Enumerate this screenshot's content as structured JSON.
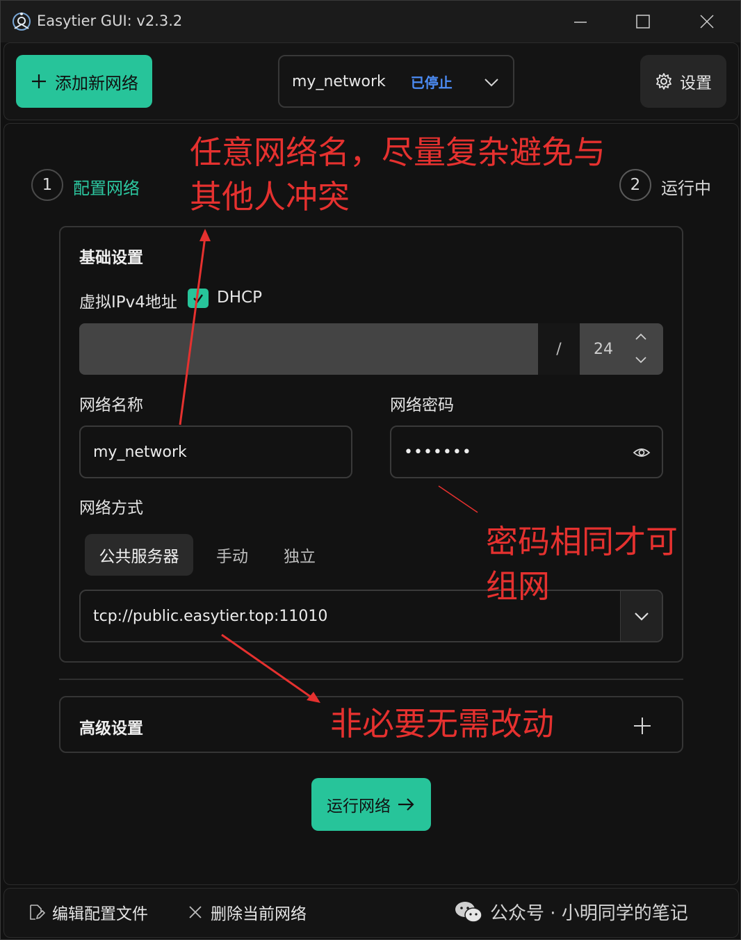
{
  "window": {
    "title": "Easytier GUI: v2.3.2"
  },
  "toolbar": {
    "add_network_label": "添加新网络",
    "network_name": "my_network",
    "network_status": "已停止",
    "settings_label": "设置"
  },
  "steps": [
    {
      "number": "1",
      "label": "配置网络"
    },
    {
      "number": "2",
      "label": "运行中"
    }
  ],
  "basic": {
    "title": "基础设置",
    "virtual_ipv4_label": "虚拟IPv4地址",
    "dhcp_label": "DHCP",
    "dhcp_checked": true,
    "ip_separator": "/",
    "netmask_value": "24",
    "network_name_label": "网络名称",
    "network_name_value": "my_network",
    "network_password_label": "网络密码",
    "network_password_value": "•••••••",
    "network_mode_label": "网络方式",
    "mode_options": [
      "公共服务器",
      "手动",
      "独立"
    ],
    "mode_selected": "公共服务器",
    "server_value": "tcp://public.easytier.top:11010"
  },
  "advanced": {
    "title": "高级设置"
  },
  "run_button_label": "运行网络",
  "footer": {
    "edit_config_label": "编辑配置文件",
    "delete_network_label": "删除当前网络",
    "watermark": "公众号 · 小明同学的笔记"
  },
  "annotations": {
    "network_name_line1": "任意网络名，尽量复杂避免与",
    "network_name_line2": "其他人冲突",
    "password_line1": "密码相同才可",
    "password_line2": "组网",
    "advanced_note": "非必要无需改动"
  },
  "colors": {
    "accent": "#27c49a",
    "status": "#4c8cf5",
    "annotation": "#e5312f",
    "background": "#121212"
  },
  "icons": {
    "app": "easytier-logo-icon",
    "add": "plus-icon",
    "dropdown": "chevron-down-icon",
    "settings": "gear-icon",
    "password_toggle": "eye-icon",
    "run": "arrow-right-icon",
    "edit": "edit-file-icon",
    "delete": "close-icon",
    "watermark": "wechat-icon"
  }
}
